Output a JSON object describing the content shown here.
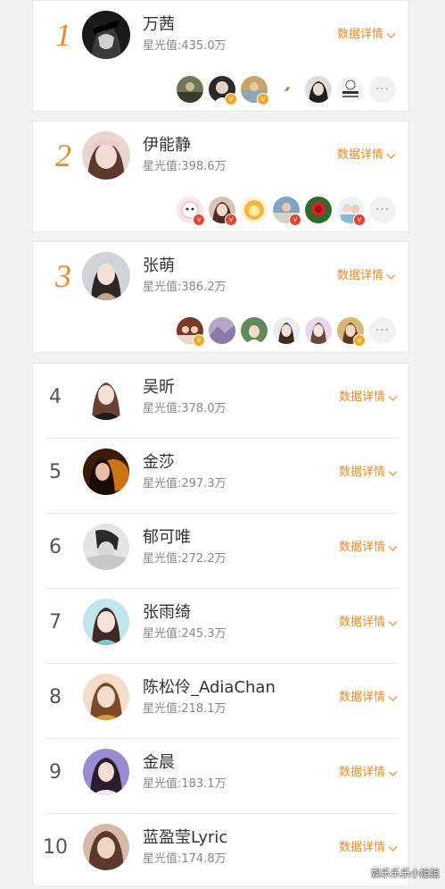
{
  "detail_label": "数据详情",
  "more_label": "···",
  "top": [
    {
      "rank": "1",
      "name": "万茜",
      "score": "星光值:435.0万"
    },
    {
      "rank": "2",
      "name": "伊能静",
      "score": "星光值:398.6万"
    },
    {
      "rank": "3",
      "name": "张萌",
      "score": "星光值:386.2万"
    }
  ],
  "list": [
    {
      "rank": "4",
      "name": "吴昕",
      "score": "星光值:378.0万"
    },
    {
      "rank": "5",
      "name": "金莎",
      "score": "星光值:297.3万"
    },
    {
      "rank": "6",
      "name": "郁可唯",
      "score": "星光值:272.2万"
    },
    {
      "rank": "7",
      "name": "张雨绮",
      "score": "星光值:245.3万"
    },
    {
      "rank": "8",
      "name": "陈松伶_AdiaChan",
      "score": "星光值:218.1万"
    },
    {
      "rank": "9",
      "name": "金晨",
      "score": "星光值:183.1万"
    },
    {
      "rank": "10",
      "name": "蓝盈莹Lyric",
      "score": "星光值:174.8万"
    }
  ],
  "fan_badge_text": "v",
  "watermark": "娱乐乐乐小姐姐",
  "colors": {
    "accent": "#f08a24",
    "background": "#f2f2f2",
    "card": "#ffffff"
  }
}
